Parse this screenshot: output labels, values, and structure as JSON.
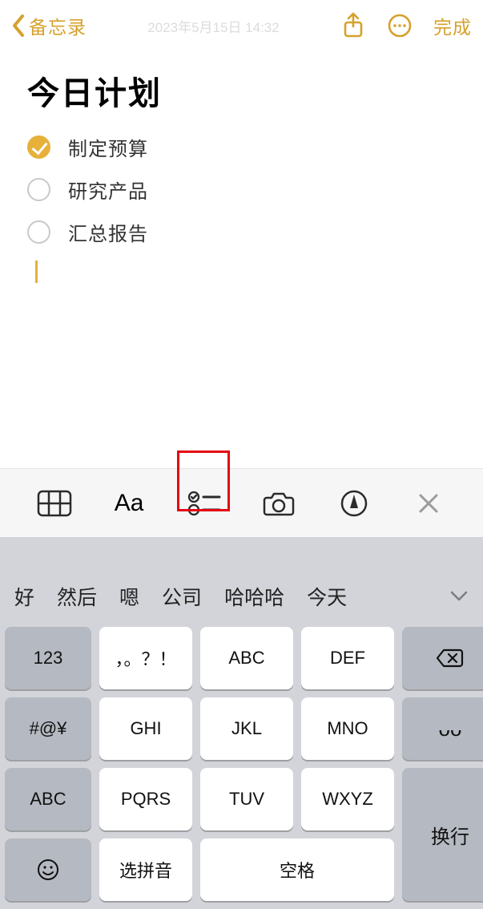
{
  "nav": {
    "back_label": "备忘录",
    "timestamp": "2023年5月15日 14:32",
    "done_label": "完成"
  },
  "note": {
    "title": "今日计划",
    "items": [
      {
        "checked": true,
        "text": "制定预算"
      },
      {
        "checked": false,
        "text": "研究产品"
      },
      {
        "checked": false,
        "text": "汇总报告"
      }
    ]
  },
  "toolbar": {
    "icons": [
      "table",
      "text-format",
      "checklist",
      "camera",
      "markup",
      "close"
    ],
    "highlighted_index": 2,
    "aa_label": "Aa"
  },
  "keyboard": {
    "suggestions": [
      "好",
      "然后",
      "嗯",
      "公司",
      "哈哈哈",
      "今天"
    ],
    "rows": {
      "r1": {
        "func": "123",
        "keys": [
          "，。？！",
          "ABC",
          "DEF"
        ],
        "right": "delete"
      },
      "r2": {
        "func": "#@¥",
        "keys": [
          "GHI",
          "JKL",
          "MNO"
        ],
        "right": "ᴗᴗ"
      },
      "r3": {
        "func": "ABC",
        "keys": [
          "PQRS",
          "TUV",
          "WXYZ"
        ]
      },
      "r4": {
        "emoji": "emoji",
        "pinyin": "选拼音",
        "space": "空格",
        "enter": "换行"
      }
    }
  }
}
